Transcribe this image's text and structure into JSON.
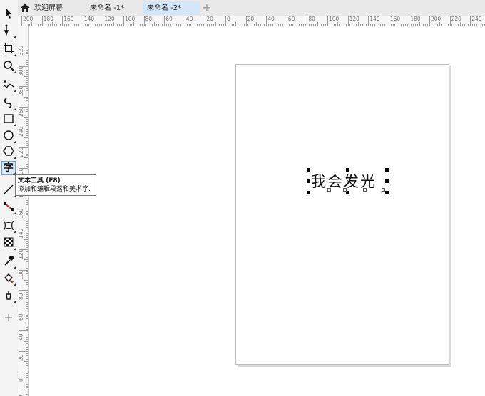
{
  "tabs": [
    {
      "label": "欢迎屏幕",
      "active": false
    },
    {
      "label": "未命名 -1*",
      "active": false
    },
    {
      "label": "未命名 -2*",
      "active": true
    }
  ],
  "toolbox": {
    "tools": [
      {
        "name": "pick-tool-icon",
        "active": false
      },
      {
        "name": "shape-tool-icon",
        "active": false
      },
      {
        "name": "crop-tool-icon",
        "active": false
      },
      {
        "name": "zoom-tool-icon",
        "active": false
      },
      {
        "name": "freehand-tool-icon",
        "active": false
      },
      {
        "name": "artistic-media-tool-icon",
        "active": false
      },
      {
        "name": "rectangle-tool-icon",
        "active": false
      },
      {
        "name": "ellipse-tool-icon",
        "active": false
      },
      {
        "name": "polygon-tool-icon",
        "active": false
      },
      {
        "name": "text-tool-icon",
        "active": true,
        "glyph": "字"
      },
      {
        "name": "parallel-dimension-tool-icon",
        "active": false
      },
      {
        "name": "connector-tool-icon",
        "active": false
      },
      {
        "name": "envelope-tool-icon",
        "active": false
      },
      {
        "name": "transparency-tool-icon",
        "active": false
      },
      {
        "name": "eyedropper-tool-icon",
        "active": false
      },
      {
        "name": "interactive-fill-tool-icon",
        "active": false
      },
      {
        "name": "smart-fill-tool-icon",
        "active": false
      },
      {
        "name": "add-tool-icon",
        "active": false
      }
    ]
  },
  "tooltip": {
    "title": "文本工具 (F8)",
    "description": "添加和编辑段落和美术字."
  },
  "ruler_top": {
    "labels": [
      "200",
      "180",
      "160",
      "140",
      "120",
      "100",
      "80",
      "60",
      "40",
      "20",
      "0",
      "20",
      "40",
      "60",
      "80",
      "100",
      "120",
      "140",
      "160",
      "180",
      "200",
      "220",
      "240"
    ]
  },
  "ruler_left": {
    "labels": [
      "320",
      "300",
      "280",
      "260",
      "240",
      "220",
      "200",
      "180",
      "160",
      "140",
      "120",
      "100",
      "80",
      "60",
      "40",
      "20",
      "0",
      "20"
    ]
  },
  "canvas": {
    "text": "我会发光"
  },
  "colors": {
    "toolbox_bg": "#f3f3f3",
    "active_tab": "#d5e6f8",
    "active_tool": "#dbe9f7"
  }
}
